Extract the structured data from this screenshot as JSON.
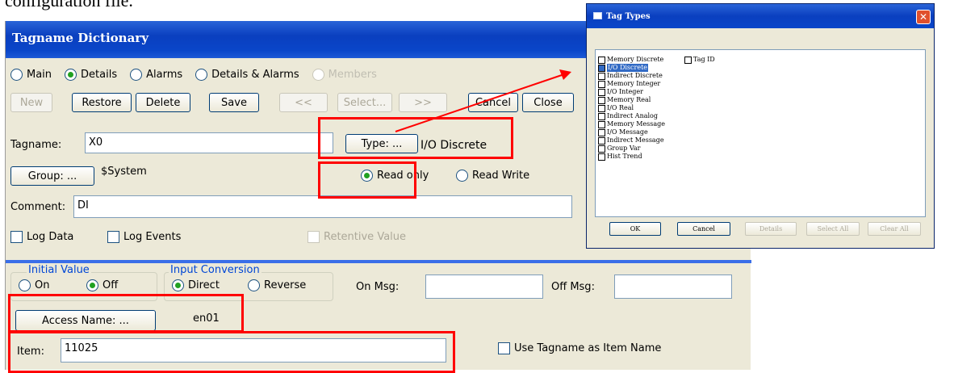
{
  "doc_fragment": "configuration file.",
  "dialog": {
    "title": "Tagname Dictionary",
    "modes": [
      {
        "label": "Main",
        "selected": false,
        "enabled": true
      },
      {
        "label": "Details",
        "selected": true,
        "enabled": true
      },
      {
        "label": "Alarms",
        "selected": false,
        "enabled": true
      },
      {
        "label": "Details & Alarms",
        "selected": false,
        "enabled": true
      },
      {
        "label": "Members",
        "selected": false,
        "enabled": false
      }
    ],
    "toolbar": {
      "new": "New",
      "restore": "Restore",
      "delete": "Delete",
      "save": "Save",
      "prev": "<<",
      "select": "Select...",
      "next": ">>",
      "cancel": "Cancel",
      "close": "Close"
    },
    "tagname_label": "Tagname:",
    "tagname_value": "X0",
    "type_button": "Type: ...",
    "type_value": "I/O Discrete",
    "group_button": "Group: ...",
    "group_value": "$System",
    "access": {
      "read_only": "Read only",
      "read_write": "Read Write",
      "selected": "read_only"
    },
    "comment_label": "Comment:",
    "comment_value": "DI",
    "log_data": "Log Data",
    "log_events": "Log Events",
    "retentive_value": "Retentive Value",
    "initial_value": {
      "legend": "Initial Value",
      "on": "On",
      "off": "Off",
      "selected": "off"
    },
    "input_conversion": {
      "legend": "Input Conversion",
      "direct": "Direct",
      "reverse": "Reverse",
      "selected": "direct"
    },
    "on_msg_label": "On Msg:",
    "on_msg_value": "",
    "off_msg_label": "Off Msg:",
    "off_msg_value": "",
    "access_name_button": "Access Name: ...",
    "access_name_value": "en01",
    "item_label": "Item:",
    "item_value": "11025",
    "use_tagname_as_item": "Use Tagname as Item Name"
  },
  "tag_types": {
    "title": "Tag Types",
    "col1": [
      {
        "label": "Memory Discrete",
        "checked": false,
        "selected": false
      },
      {
        "label": "I/O Discrete",
        "checked": true,
        "selected": true
      },
      {
        "label": "Indirect Discrete",
        "checked": false,
        "selected": false
      },
      {
        "label": "Memory Integer",
        "checked": false,
        "selected": false
      },
      {
        "label": "I/O Integer",
        "checked": false,
        "selected": false
      },
      {
        "label": "Memory Real",
        "checked": false,
        "selected": false
      },
      {
        "label": "I/O Real",
        "checked": false,
        "selected": false
      },
      {
        "label": "Indirect Analog",
        "checked": false,
        "selected": false
      },
      {
        "label": "Memory Message",
        "checked": false,
        "selected": false
      },
      {
        "label": "I/O Message",
        "checked": false,
        "selected": false
      },
      {
        "label": "Indirect Message",
        "checked": false,
        "selected": false
      },
      {
        "label": "Group Var",
        "checked": false,
        "selected": false
      },
      {
        "label": "Hist Trend",
        "checked": false,
        "selected": false
      }
    ],
    "col2": [
      {
        "label": "Tag ID",
        "checked": false,
        "selected": false
      }
    ],
    "buttons": {
      "ok": "OK",
      "cancel": "Cancel",
      "details": "Details",
      "select_all": "Select All",
      "clear_all": "Clear All"
    }
  },
  "colors": {
    "highlight": "#ff0000",
    "title_bar": "#0a46c9",
    "dialog_bg": "#ece9d8"
  }
}
